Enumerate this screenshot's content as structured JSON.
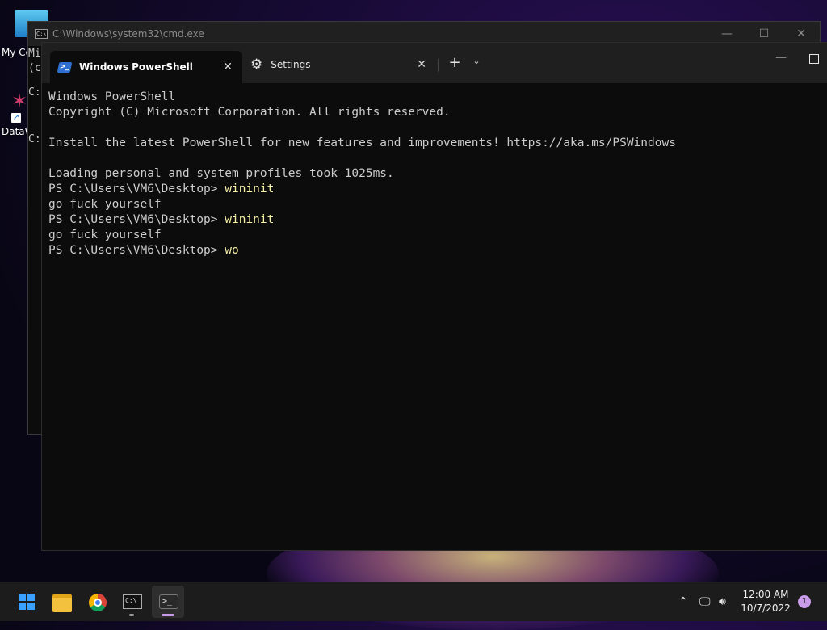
{
  "desktop": {
    "icons": [
      {
        "label": "My Co",
        "icon": "computer-icon"
      },
      {
        "label": "DataW",
        "icon": "datawatch-icon"
      }
    ]
  },
  "cmd_window": {
    "title": "C:\\Windows\\system32\\cmd.exe",
    "partial_text": [
      "Mi",
      "(c",
      "C:",
      "C:"
    ]
  },
  "terminal": {
    "tabs": [
      {
        "label": "Windows PowerShell",
        "icon": "powershell-icon",
        "active": true
      },
      {
        "label": "Settings",
        "icon": "gear-icon",
        "active": false
      }
    ],
    "new_tab_symbol": "+",
    "lines": [
      {
        "prompt": "Windows PowerShell",
        "cmd": ""
      },
      {
        "prompt": "Copyright (C) Microsoft Corporation. All rights reserved.",
        "cmd": ""
      },
      {
        "prompt": "",
        "cmd": ""
      },
      {
        "prompt": "Install the latest PowerShell for new features and improvements! https://aka.ms/PSWindows",
        "cmd": ""
      },
      {
        "prompt": "",
        "cmd": ""
      },
      {
        "prompt": "Loading personal and system profiles took 1025ms.",
        "cmd": ""
      },
      {
        "prompt": "PS C:\\Users\\VM6\\Desktop> ",
        "cmd": "wininit"
      },
      {
        "prompt": "go fuck yourself",
        "cmd": ""
      },
      {
        "prompt": "PS C:\\Users\\VM6\\Desktop> ",
        "cmd": "wininit"
      },
      {
        "prompt": "go fuck yourself",
        "cmd": ""
      },
      {
        "prompt": "PS C:\\Users\\VM6\\Desktop> ",
        "cmd": "wo"
      }
    ]
  },
  "taskbar": {
    "apps": [
      {
        "name": "start",
        "icon": "windows-start-icon"
      },
      {
        "name": "file-explorer",
        "icon": "folder-icon"
      },
      {
        "name": "chrome",
        "icon": "chrome-icon"
      },
      {
        "name": "cmd",
        "icon": "cmd-icon"
      },
      {
        "name": "terminal",
        "icon": "terminal-icon",
        "active": true
      }
    ],
    "time": "12:00 AM",
    "date": "10/7/2022",
    "notification_count": "1"
  }
}
